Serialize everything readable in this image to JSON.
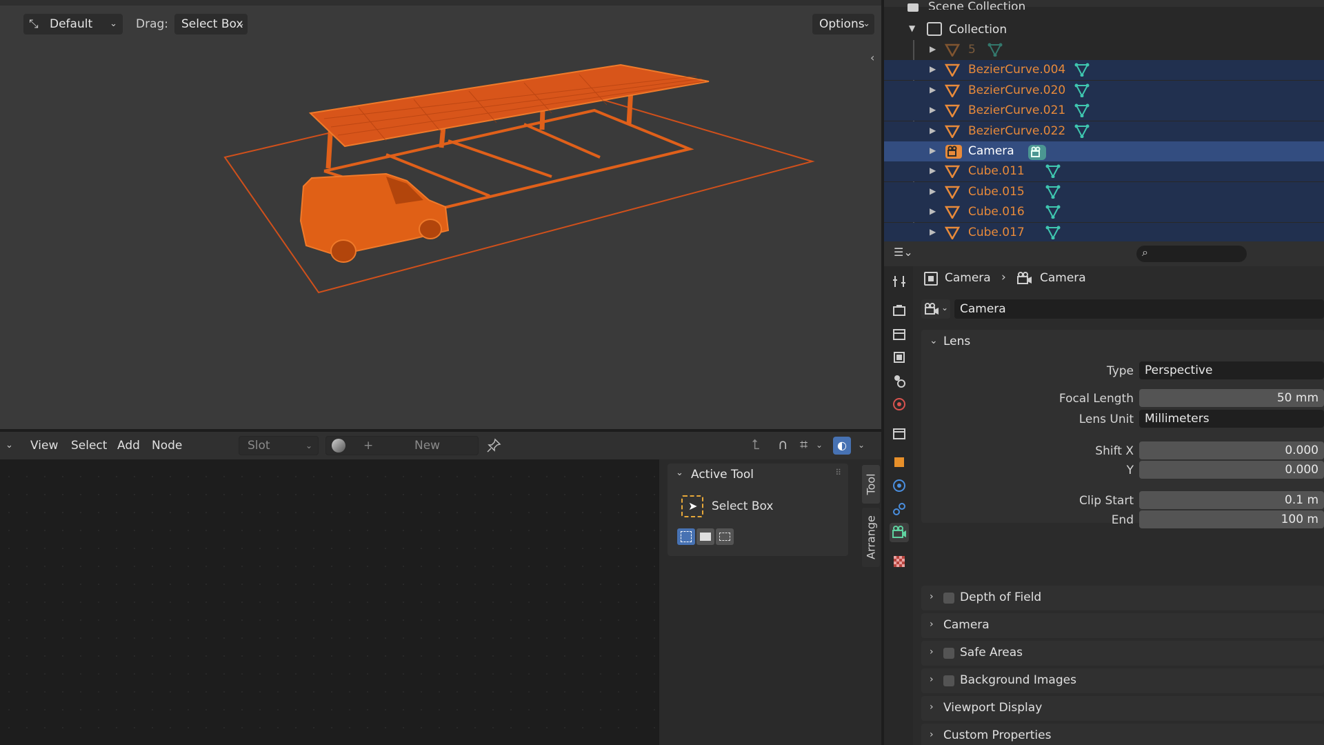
{
  "viewport": {
    "header": {
      "orientation_value": "Default",
      "drag_label": "Drag:",
      "drag_value": "Select Box",
      "options_label": "Options"
    }
  },
  "node_editor": {
    "menus": [
      "View",
      "Select",
      "Add",
      "Node"
    ],
    "slot_placeholder": "Slot",
    "new_label": "New",
    "active_tool": {
      "panel_title": "Active Tool",
      "tool_name": "Select Box"
    },
    "tabs": [
      "Tool",
      "Arrange"
    ]
  },
  "outliner": {
    "scene_collection": "Scene Collection",
    "collection": "Collection",
    "items": [
      {
        "name": "5",
        "type": "curve",
        "state": "dim"
      },
      {
        "name": "BezierCurve.004",
        "type": "curve",
        "state": "selected"
      },
      {
        "name": "BezierCurve.020",
        "type": "curve",
        "state": "selected"
      },
      {
        "name": "BezierCurve.021",
        "type": "curve",
        "state": "selected"
      },
      {
        "name": "BezierCurve.022",
        "type": "curve",
        "state": "selected"
      },
      {
        "name": "Camera",
        "type": "camera",
        "state": "active"
      },
      {
        "name": "Cube.011",
        "type": "mesh",
        "state": "selected"
      },
      {
        "name": "Cube.015",
        "type": "mesh",
        "state": "selected"
      },
      {
        "name": "Cube.016",
        "type": "mesh",
        "state": "selected"
      },
      {
        "name": "Cube.017",
        "type": "mesh",
        "state": "selected"
      }
    ]
  },
  "properties": {
    "breadcrumb": {
      "object": "Camera",
      "data": "Camera"
    },
    "datablock_name": "Camera",
    "lens": {
      "title": "Lens",
      "type_label": "Type",
      "type_value": "Perspective",
      "focal_label": "Focal Length",
      "focal_value": "50 mm",
      "unit_label": "Lens Unit",
      "unit_value": "Millimeters",
      "shiftx_label": "Shift X",
      "shiftx_value": "0.000",
      "shifty_label": "Y",
      "shifty_value": "0.000",
      "clipstart_label": "Clip Start",
      "clipstart_value": "0.1 m",
      "clipend_label": "End",
      "clipend_value": "100 m"
    },
    "panels": [
      {
        "title": "Depth of Field",
        "checkbox": true
      },
      {
        "title": "Camera",
        "checkbox": false
      },
      {
        "title": "Safe Areas",
        "checkbox": true
      },
      {
        "title": "Background Images",
        "checkbox": true
      },
      {
        "title": "Viewport Display",
        "checkbox": false
      },
      {
        "title": "Custom Properties",
        "checkbox": false
      }
    ]
  },
  "colors": {
    "selected_orange": "#e36a12",
    "active_row": "#334d80",
    "selected_row": "#21304f",
    "mesh_icon_teal": "#3fc7b0",
    "camera_icon_green": "#5fd3a0"
  }
}
